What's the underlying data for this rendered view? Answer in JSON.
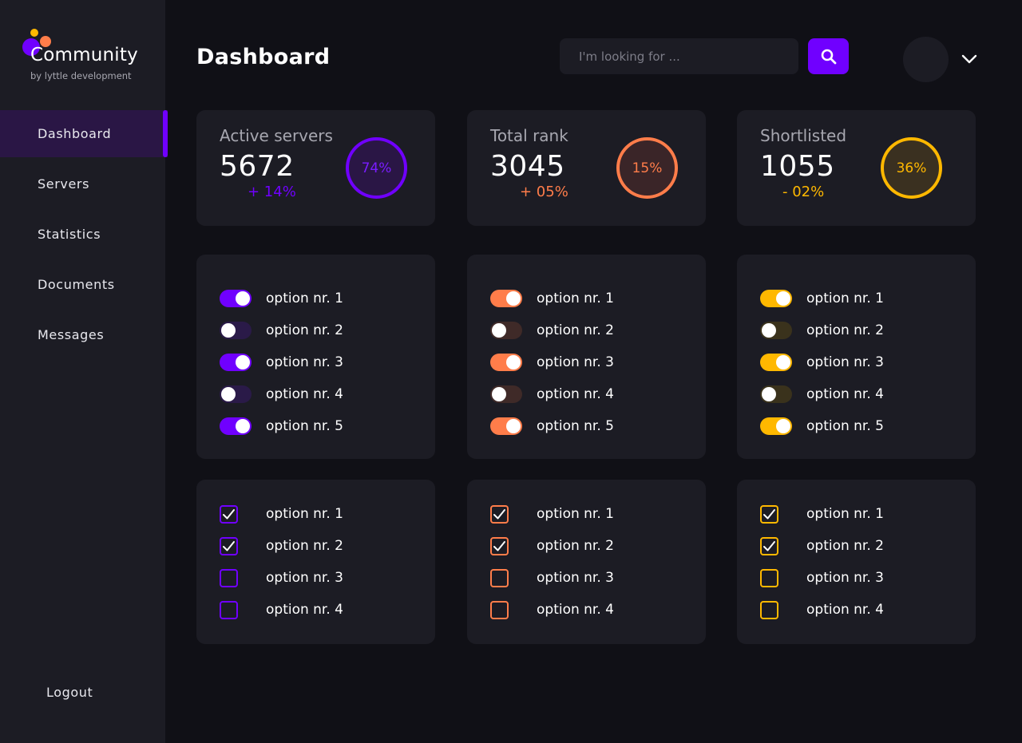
{
  "brand": {
    "name": "Community",
    "tagline": "by lyttle development"
  },
  "sidebar": {
    "items": [
      {
        "label": "Dashboard",
        "active": true
      },
      {
        "label": "Servers",
        "active": false
      },
      {
        "label": "Statistics",
        "active": false
      },
      {
        "label": "Documents",
        "active": false
      },
      {
        "label": "Messages",
        "active": false
      }
    ],
    "logout_label": "Logout"
  },
  "header": {
    "title": "Dashboard",
    "search_placeholder": "I'm looking for ...",
    "search_icon": "search-icon",
    "menu_icon": "chevron-down-icon"
  },
  "colors": {
    "purple": "#7000ff",
    "orange": "#ff7d4a",
    "yellow": "#ffb800"
  },
  "stats": [
    {
      "label": "Active servers",
      "value": "5672",
      "change": "+ 14%",
      "percent": "74%",
      "color": "#7000ff",
      "ring_bg": "#2a1645",
      "ring_text": "#7a1cff"
    },
    {
      "label": "Total rank",
      "value": "3045",
      "change": "+ 05%",
      "percent": "15%",
      "color": "#ff7d4a",
      "ring_bg": "#3a2528",
      "ring_text": "#ff7d4a"
    },
    {
      "label": "Shortlisted",
      "value": "1055",
      "change": "- 02%",
      "percent": "36%",
      "color": "#ffb800",
      "ring_bg": "#3a3020",
      "ring_text": "#ffb800"
    }
  ],
  "toggle_groups": [
    {
      "color": "#7000ff",
      "off_bg": "#2a1a48",
      "options": [
        {
          "label": "option nr. 1",
          "on": true
        },
        {
          "label": "option nr. 2",
          "on": false
        },
        {
          "label": "option nr. 3",
          "on": true
        },
        {
          "label": "option nr. 4",
          "on": false
        },
        {
          "label": "option nr. 5",
          "on": true
        }
      ]
    },
    {
      "color": "#ff7d4a",
      "off_bg": "#3f2a28",
      "options": [
        {
          "label": "option nr. 1",
          "on": true
        },
        {
          "label": "option nr. 2",
          "on": false
        },
        {
          "label": "option nr. 3",
          "on": true
        },
        {
          "label": "option nr. 4",
          "on": false
        },
        {
          "label": "option nr. 5",
          "on": true
        }
      ]
    },
    {
      "color": "#ffb800",
      "off_bg": "#3a321c",
      "options": [
        {
          "label": "option nr. 1",
          "on": true
        },
        {
          "label": "option nr. 2",
          "on": false
        },
        {
          "label": "option nr. 3",
          "on": true
        },
        {
          "label": "option nr. 4",
          "on": false
        },
        {
          "label": "option nr. 5",
          "on": true
        }
      ]
    }
  ],
  "checkbox_groups": [
    {
      "color": "#7000ff",
      "options": [
        {
          "label": "option nr. 1",
          "checked": true
        },
        {
          "label": "option nr. 2",
          "checked": true
        },
        {
          "label": "option nr. 3",
          "checked": false
        },
        {
          "label": "option nr. 4",
          "checked": false
        }
      ]
    },
    {
      "color": "#ff7d4a",
      "options": [
        {
          "label": "option nr. 1",
          "checked": true
        },
        {
          "label": "option nr. 2",
          "checked": true
        },
        {
          "label": "option nr. 3",
          "checked": false
        },
        {
          "label": "option nr. 4",
          "checked": false
        }
      ]
    },
    {
      "color": "#ffb800",
      "options": [
        {
          "label": "option nr. 1",
          "checked": true
        },
        {
          "label": "option nr. 2",
          "checked": true
        },
        {
          "label": "option nr. 3",
          "checked": false
        },
        {
          "label": "option nr. 4",
          "checked": false
        }
      ]
    }
  ]
}
